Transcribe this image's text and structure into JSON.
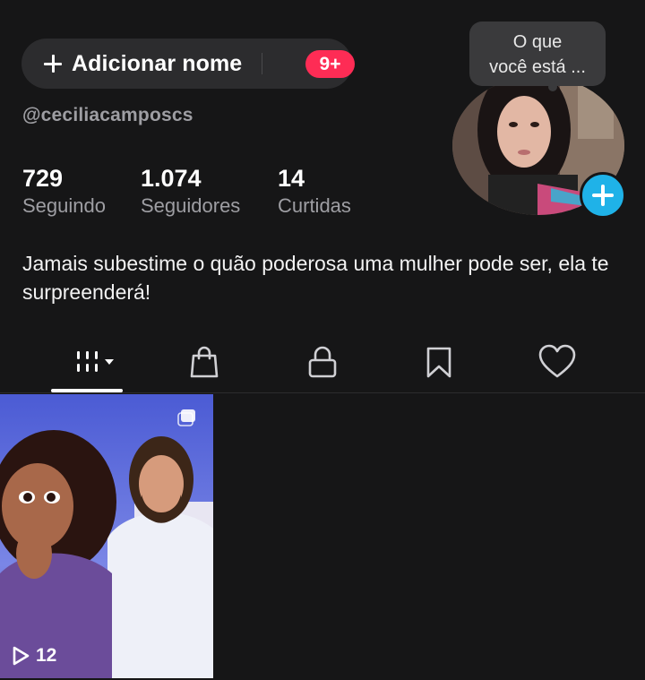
{
  "header": {
    "add_name_label": "Adicionar nome",
    "notification_badge": "9+",
    "username": "@ceciliacamposcs"
  },
  "stats": [
    {
      "value": "729",
      "label": "Seguindo"
    },
    {
      "value": "1.074",
      "label": "Seguidores"
    },
    {
      "value": "14",
      "label": "Curtidas"
    }
  ],
  "bio": "Jamais subestime o quão poderosa uma mulher pode ser, ela te surpreenderá!",
  "note_bubble": {
    "line1": "O que",
    "line2": "você está ..."
  },
  "tabs": [
    {
      "icon": "grid-icon",
      "active": true
    },
    {
      "icon": "shopping-bag-icon",
      "active": false
    },
    {
      "icon": "lock-icon",
      "active": false
    },
    {
      "icon": "bookmark-icon",
      "active": false
    },
    {
      "icon": "heart-icon",
      "active": false
    }
  ],
  "videos": [
    {
      "play_count": "12"
    }
  ],
  "colors": {
    "background": "#161617",
    "badge": "#fe2c55",
    "avatar_add": "#1fb2e8",
    "secondary_text": "#9e9ea3"
  }
}
